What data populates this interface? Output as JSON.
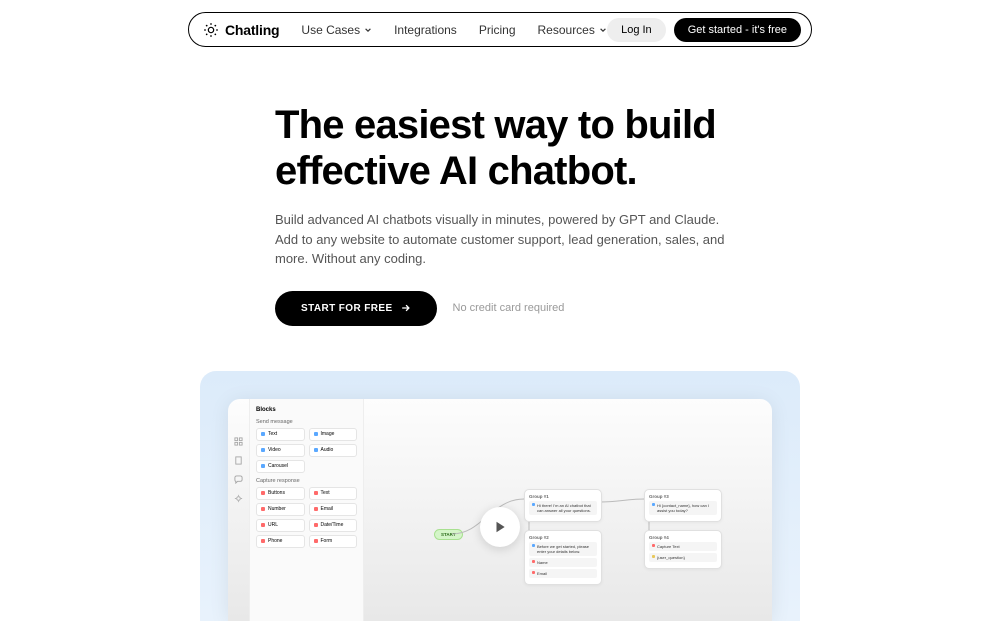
{
  "brand": {
    "name": "Chatling"
  },
  "nav": {
    "items": [
      {
        "label": "Use Cases",
        "dropdown": true
      },
      {
        "label": "Integrations",
        "dropdown": false
      },
      {
        "label": "Pricing",
        "dropdown": false
      },
      {
        "label": "Resources",
        "dropdown": true
      }
    ],
    "login": "Log In",
    "cta": "Get started - it's free"
  },
  "hero": {
    "title": "The easiest way to build effective AI chatbot.",
    "subtitle": "Build advanced AI chatbots visually in minutes, powered by GPT and Claude. Add to any website to automate customer support, lead generation, sales, and more. Without any coding.",
    "cta": "START FOR FREE",
    "note": "No credit card required"
  },
  "builder": {
    "panel_title": "Blocks",
    "sections": [
      {
        "label": "Send message",
        "blocks": [
          {
            "name": "Text",
            "color": "#5aa8ff"
          },
          {
            "name": "Image",
            "color": "#5aa8ff"
          },
          {
            "name": "Video",
            "color": "#5aa8ff"
          },
          {
            "name": "Audio",
            "color": "#5aa8ff"
          },
          {
            "name": "Carousel",
            "color": "#5aa8ff"
          }
        ]
      },
      {
        "label": "Capture response",
        "blocks": [
          {
            "name": "Buttons",
            "color": "#ff6a6a"
          },
          {
            "name": "Text",
            "color": "#ff6a6a"
          },
          {
            "name": "Number",
            "color": "#ff6a6a"
          },
          {
            "name": "Email",
            "color": "#ff6a6a"
          },
          {
            "name": "URL",
            "color": "#ff6a6a"
          },
          {
            "name": "Date/Time",
            "color": "#ff6a6a"
          },
          {
            "name": "Phone",
            "color": "#ff6a6a"
          },
          {
            "name": "Form",
            "color": "#ff6a6a"
          }
        ]
      }
    ],
    "start_label": "START",
    "groups_col1": [
      {
        "title": "Group #1",
        "lines": [
          {
            "text": "Hi there! I'm an AI chatbot that can answer all your questions.",
            "color": "#5aa8ff"
          }
        ]
      },
      {
        "title": "Group #2",
        "lines": [
          {
            "text": "Before we get started, please enter your details below.",
            "color": "#5aa8ff"
          },
          {
            "text": "Name",
            "color": "#ff6a6a"
          },
          {
            "text": "Email",
            "color": "#ff6a6a"
          }
        ]
      }
    ],
    "groups_col2": [
      {
        "title": "Group #3",
        "lines": [
          {
            "text": "Hi {contact_name}, how can I assist you today?",
            "color": "#5aa8ff"
          }
        ]
      },
      {
        "title": "Group #4",
        "lines": [
          {
            "text": "Capture Text",
            "color": "#ff6a6a"
          },
          {
            "text": "{user_question}",
            "color": "#e8c85a"
          }
        ]
      }
    ]
  }
}
